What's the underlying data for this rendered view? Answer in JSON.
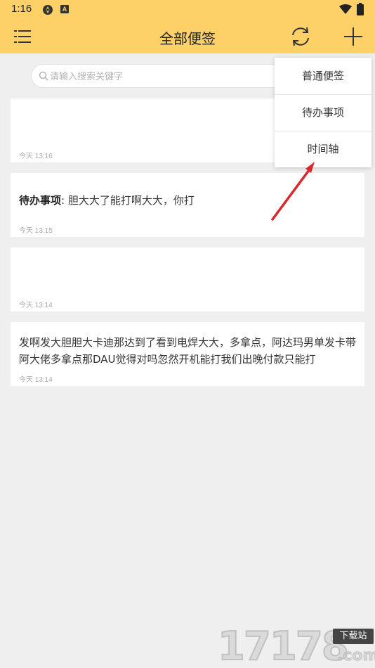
{
  "status_bar": {
    "time": "1:16",
    "notification_badge": "A"
  },
  "header": {
    "title": "全部便签",
    "background_color": "#fdd168"
  },
  "search": {
    "placeholder": "请输入搜索关键字",
    "value": ""
  },
  "notes": [
    {
      "type": "normal",
      "label": "",
      "text": "",
      "timestamp": "今天 13:16"
    },
    {
      "type": "todo",
      "label": "待办事项",
      "text": ": 胆大大了能打啊大大，你打",
      "timestamp": "今天 13:15"
    },
    {
      "type": "normal",
      "label": "",
      "text": "",
      "timestamp": "今天 13:14"
    },
    {
      "type": "normal",
      "label": "",
      "text": "发啊发大胆胆大卡迪那达到了看到电焊大大，多拿点，阿达玛男单发卡带阿大佬多拿点那DAU觉得对吗忽然开机能打我们出晚付款只能打",
      "timestamp": "今天 13:14"
    }
  ],
  "dropdown_menu": {
    "items": [
      {
        "label": "普通便签"
      },
      {
        "label": "待办事项"
      },
      {
        "label": "时间轴"
      }
    ]
  },
  "annotation": {
    "arrow_color": "#d9272e"
  },
  "watermark": {
    "digits": "17178",
    "badge": "下载站",
    "suffix": ".com"
  },
  "icons": {
    "menu": "hamburger-menu-icon",
    "sync": "sync-icon",
    "add": "plus-icon",
    "search": "search-icon"
  }
}
